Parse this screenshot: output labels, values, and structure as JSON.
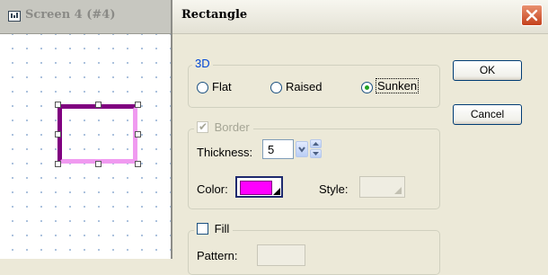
{
  "screen_window": {
    "title": "Screen 4 (#4)",
    "shape_colors": {
      "top_left": "#800080",
      "bottom_right": "#f09af0"
    }
  },
  "dialog": {
    "title": "Rectangle",
    "ok_label": "OK",
    "cancel_label": "Cancel",
    "group_3d": {
      "label": "3D",
      "options": [
        "Flat",
        "Raised",
        "Sunken"
      ],
      "selected": "Sunken"
    },
    "border": {
      "label": "Border",
      "checked": true,
      "thickness_label": "Thickness:",
      "thickness_value": "5",
      "color_label": "Color:",
      "color_value": "#ff00ff",
      "style_label": "Style:"
    },
    "fill": {
      "label": "Fill",
      "checked": false,
      "pattern_label": "Pattern:"
    }
  }
}
